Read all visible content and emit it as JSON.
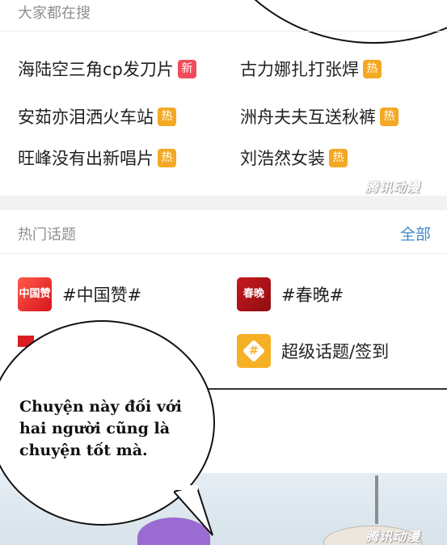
{
  "search_section": {
    "title": "大家都在搜",
    "items": [
      {
        "label": "海陆空三角cp发刀片",
        "badge": "新",
        "badge_type": "new"
      },
      {
        "label": "古力娜扎打张焊",
        "badge": "热",
        "badge_type": "hot"
      },
      {
        "label": "安茹亦泪洒火车站",
        "badge": "热",
        "badge_type": "hot"
      },
      {
        "label": "洲舟夫夫互送秋裤",
        "badge": "热",
        "badge_type": "hot"
      },
      {
        "label": "旺峰没有出新唱片",
        "badge": "热",
        "badge_type": "hot"
      },
      {
        "label": "刘浩然女装",
        "badge": "热",
        "badge_type": "hot"
      }
    ]
  },
  "topics_section": {
    "title": "热门话题",
    "all_label": "全部",
    "topics": [
      {
        "label": "#中国赞#",
        "icon": "zhongguo-zan-icon",
        "icon_text": "中国赞"
      },
      {
        "label": "#春晚#",
        "icon": "chunwan-icon",
        "icon_text": "春晚"
      },
      {
        "label": "超级话题/签到",
        "icon": "super-topic-icon",
        "icon_text": "#"
      }
    ]
  },
  "watermarks": [
    "腾讯动漫",
    "腾讯动漫"
  ],
  "speech_bubble": {
    "text": "Chuyện này đối với hai người cũng là chuyện tốt mà."
  },
  "colors": {
    "hot_badge": "#f4a823",
    "new_badge": "#f04c5c",
    "link": "#3f87cc"
  }
}
